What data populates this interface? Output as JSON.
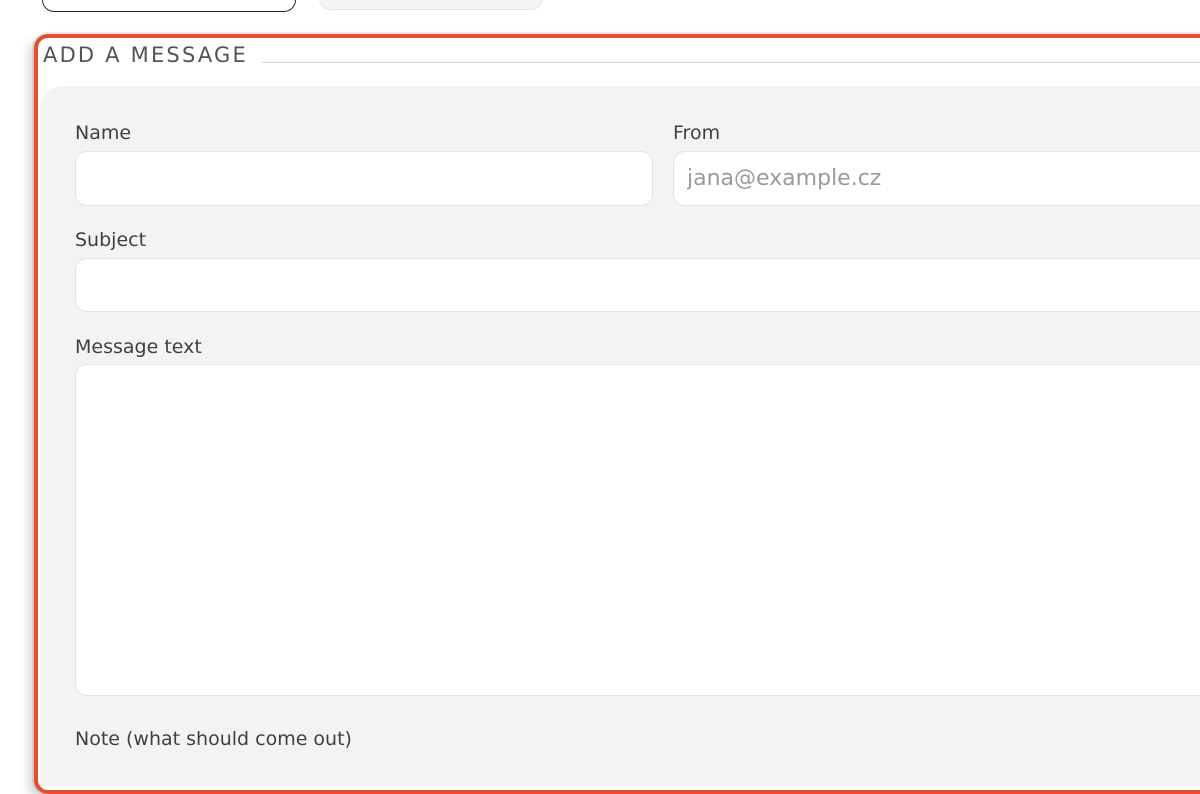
{
  "form": {
    "legend": "ADD A MESSAGE",
    "name_label": "Name",
    "name_value": "",
    "from_label": "From",
    "from_placeholder": "jana@example.cz",
    "subject_label": "Subject",
    "subject_value": "",
    "message_label": "Message text",
    "message_value": "",
    "note_label": "Note (what should come out)"
  },
  "colors": {
    "accent_border": "#e0522f",
    "panel_background": "#f3f3f2"
  }
}
